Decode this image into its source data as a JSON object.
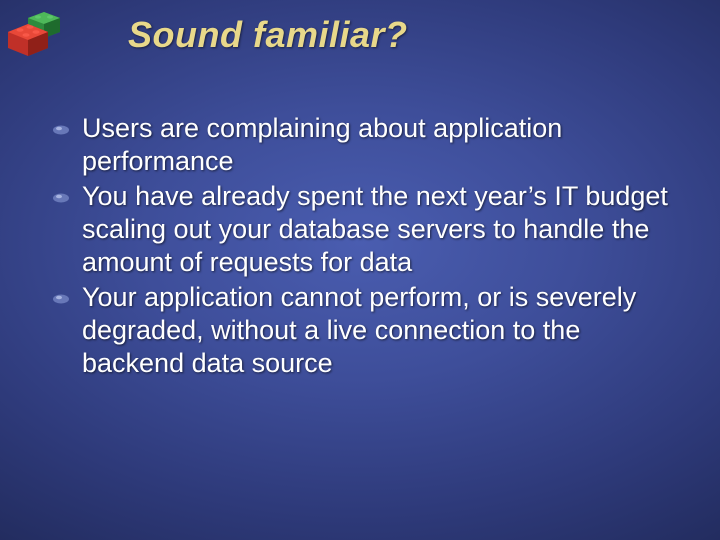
{
  "title": "Sound familiar?",
  "bullets": [
    "Users are complaining about application performance",
    "You have already spent the next year’s IT budget scaling out your database servers to handle the amount of requests for data",
    "Your application cannot perform, or is severely degraded, without a live connection to the backend data source"
  ]
}
